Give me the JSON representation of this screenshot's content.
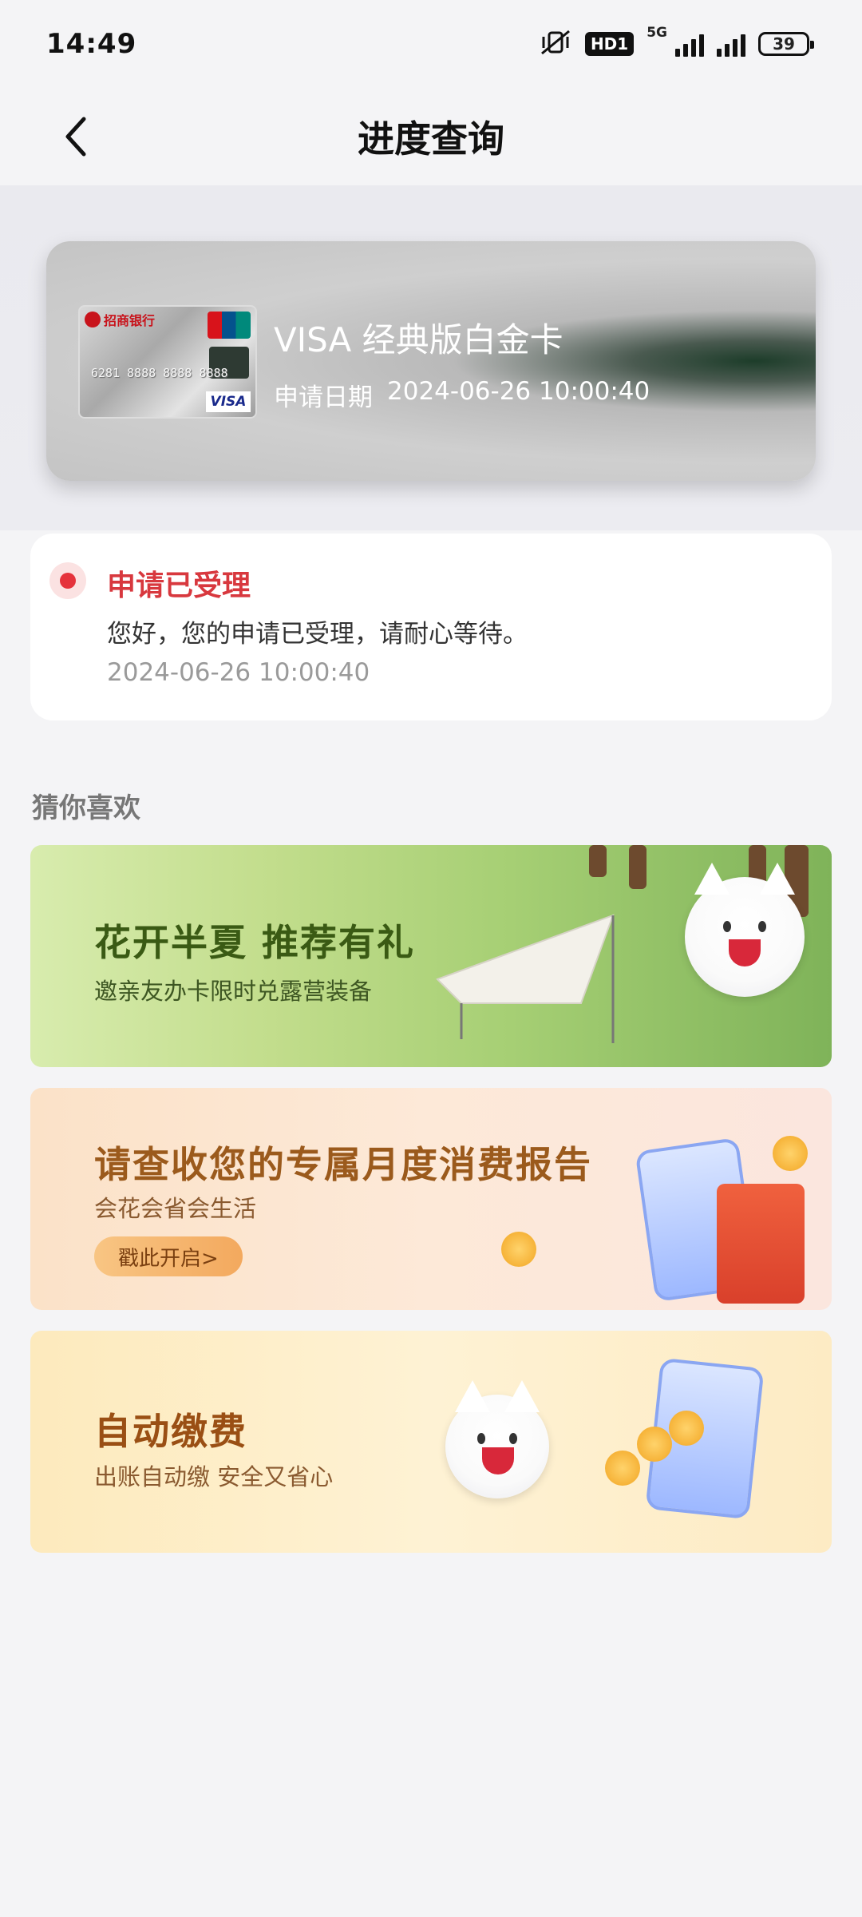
{
  "status_bar": {
    "time": "14:49",
    "network_badge": "HD1",
    "network_type": "5G",
    "battery": "39"
  },
  "header": {
    "title": "进度查询",
    "back_icon": "chevron-left-icon"
  },
  "card": {
    "name": "VISA 经典版白金卡",
    "date_label": "申请日期",
    "date_value": "2024-06-26 10:00:40",
    "thumb_bank": "招商银行",
    "thumb_number": "6281 8888 8888 8888",
    "thumb_brand": "VISA"
  },
  "application_status": {
    "title": "申请已受理",
    "description": "您好，您的申请已受理，请耐心等待。",
    "timestamp": "2024-06-26 10:00:40",
    "status_color": "#e5333c"
  },
  "recommendations": {
    "section_title": "猜你喜欢",
    "banners": [
      {
        "headline": "花开半夏  推荐有礼",
        "subtitle": "邀亲友办卡限时兑露营装备"
      },
      {
        "headline": "请查收您的专属月度消费报告",
        "subtitle": "会花会省会生活",
        "cta": "戳此开启>"
      },
      {
        "headline": "自动缴费",
        "subtitle": "出账自动缴 安全又省心"
      }
    ]
  }
}
